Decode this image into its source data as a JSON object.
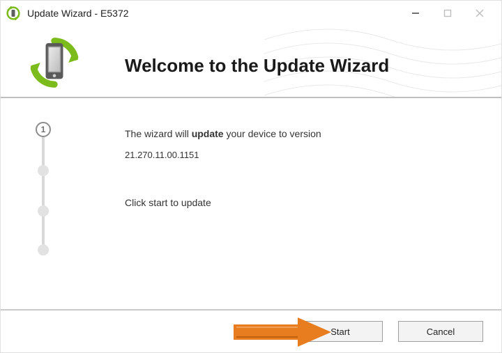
{
  "window": {
    "title": "Update Wizard - E5372"
  },
  "header": {
    "welcome": "Welcome to the Update Wizard"
  },
  "body": {
    "line1_prefix": "The wizard will",
    "line1_bold": " update ",
    "line1_suffix": "your device to version",
    "version": "21.270.11.00.1151",
    "line2": "Click start to update"
  },
  "steps": {
    "active_label": "1"
  },
  "footer": {
    "start_label": "Start",
    "cancel_label": "Cancel"
  },
  "colors": {
    "accent_green": "#7cbb1c",
    "arrow": "#e77d1f"
  }
}
